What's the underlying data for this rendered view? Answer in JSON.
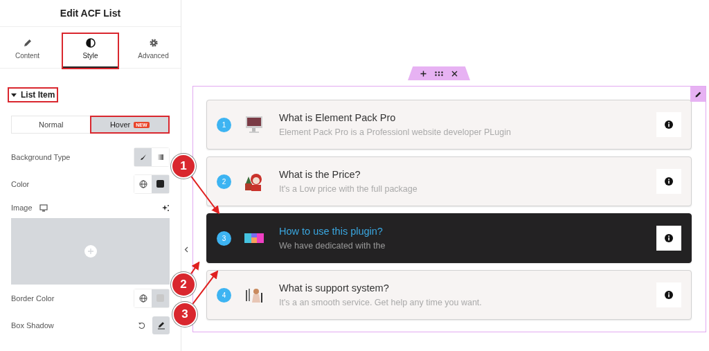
{
  "panel": {
    "title": "Edit ACF List",
    "tabs": [
      {
        "label": "Content",
        "selected": false,
        "annotated": false
      },
      {
        "label": "Style",
        "selected": true,
        "annotated": true
      },
      {
        "label": "Advanced",
        "selected": false,
        "annotated": false
      }
    ],
    "section": {
      "title": "List Item",
      "expanded": true,
      "annotated": true
    },
    "states": [
      {
        "label": "Normal",
        "selected": false,
        "annotated": false
      },
      {
        "label": "Hover",
        "badge": "NEW",
        "selected": true,
        "annotated": true
      }
    ],
    "controls": [
      {
        "kind": "choice",
        "label": "Background Type",
        "options": [
          {
            "kind": "classic",
            "selected": true
          },
          {
            "kind": "gradient",
            "selected": false
          }
        ]
      },
      {
        "kind": "color",
        "label": "Color",
        "color": "#222222"
      },
      {
        "label": "Image"
      },
      {
        "kind": "color",
        "label": "Border Color",
        "color": "#c8c8c8"
      },
      {
        "kind": "shadow",
        "label": "Box Shadow"
      }
    ]
  },
  "list": {
    "items": [
      {
        "number": "1",
        "title": "What is Element Pack Pro",
        "text": "Element Pack Pro is a Professionl website developer PLugin",
        "hover": false
      },
      {
        "number": "2",
        "title": "What is the Price?",
        "text": "It's a Low price with the full package",
        "hover": false
      },
      {
        "number": "3",
        "title": "How to use this plugin?",
        "text": "We have dedicated with the",
        "hover": true
      },
      {
        "number": "4",
        "title": "What is support system?",
        "text": "It's a an smooth service. Get help any time you want.",
        "hover": false
      }
    ]
  },
  "callouts": [
    "1",
    "2",
    "3"
  ]
}
